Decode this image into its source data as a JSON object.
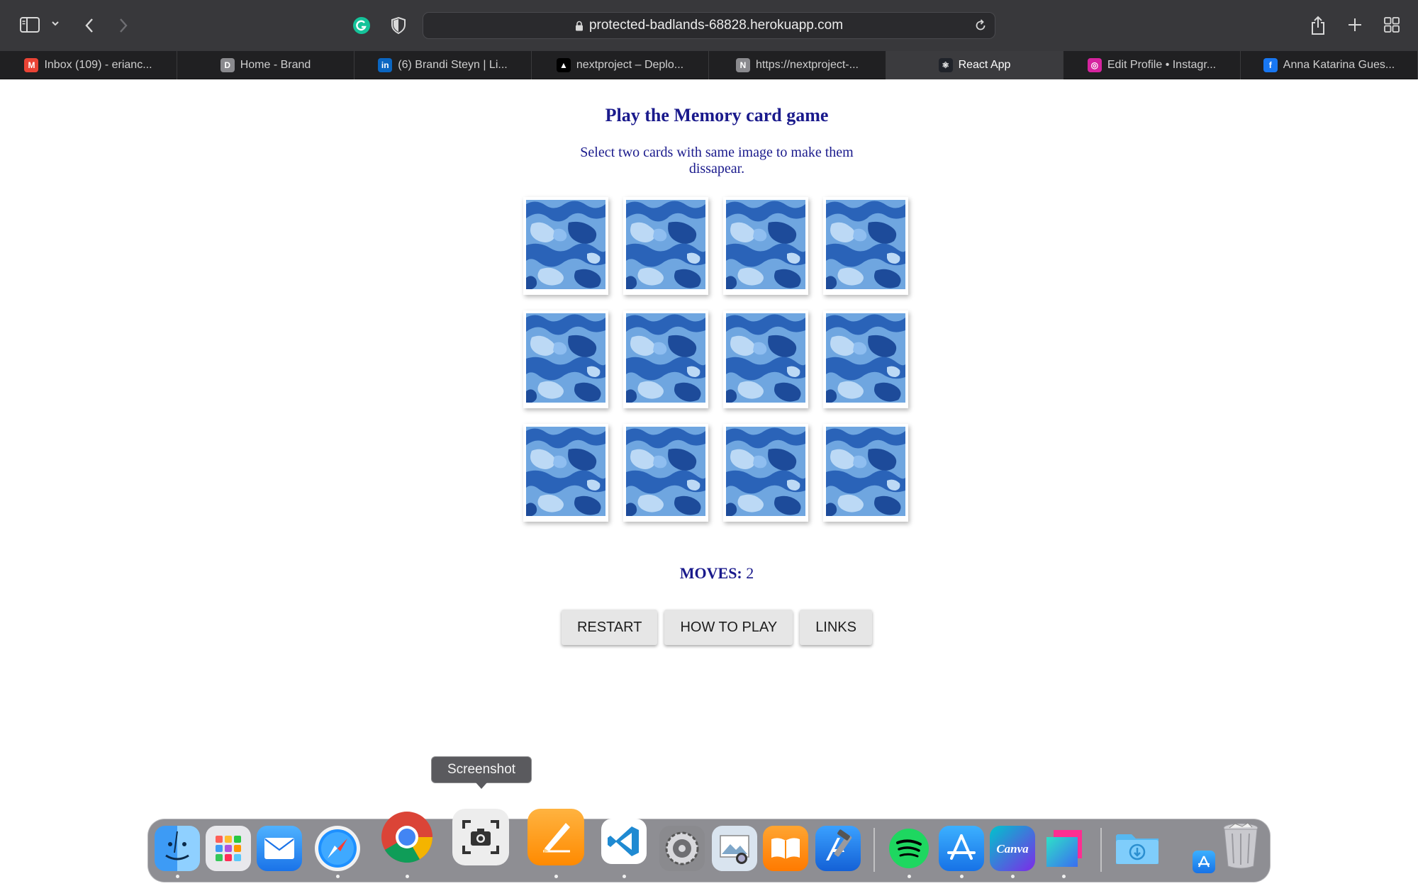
{
  "browser": {
    "url": "protected-badlands-68828.herokuapp.com",
    "tabs": [
      {
        "label": "Inbox (109) - erianc...",
        "icon": "gmail-icon",
        "color": "#ea4335",
        "glyph": "M"
      },
      {
        "label": "Home - Brand",
        "icon": "d-icon",
        "color": "#8a8a8e",
        "glyph": "D"
      },
      {
        "label": "(6) Brandi Steyn | Li...",
        "icon": "linkedin-icon",
        "color": "#0a66c2",
        "glyph": "in"
      },
      {
        "label": "nextproject – Deplo...",
        "icon": "vercel-icon",
        "color": "#000000",
        "glyph": "▲"
      },
      {
        "label": "https://nextproject-...",
        "icon": "n-icon",
        "color": "#8a8a8e",
        "glyph": "N"
      },
      {
        "label": "React App",
        "icon": "react-icon",
        "color": "#20232a",
        "glyph": "⚛"
      },
      {
        "label": "Edit Profile • Instagr...",
        "icon": "instagram-icon",
        "color": "#d6249f",
        "glyph": "◎"
      },
      {
        "label": "Anna Katarina Gues...",
        "icon": "facebook-icon",
        "color": "#1877f2",
        "glyph": "f"
      }
    ]
  },
  "game": {
    "title": "Play the Memory card game",
    "instructions": "Select two cards with same image to make them dissapear.",
    "moves_label": "MOVES:",
    "moves_value": "2",
    "card_rows": 3,
    "card_cols": 4
  },
  "controls": {
    "restart": "RESTART",
    "how_to_play": "HOW TO PLAY",
    "links": "LINKS"
  },
  "tooltip": "Screenshot",
  "dock": [
    "finder-icon",
    "launchpad-icon",
    "mail-icon",
    "safari-icon",
    "chrome-icon",
    "screenshot-icon",
    "pages-icon",
    "vscode-icon",
    "system-preferences-icon",
    "preview-icon",
    "books-icon",
    "xcode-icon",
    "spotify-icon",
    "app-store-icon",
    "canva-icon",
    "screens-icon",
    "downloads-folder-icon",
    "trash-icon"
  ]
}
